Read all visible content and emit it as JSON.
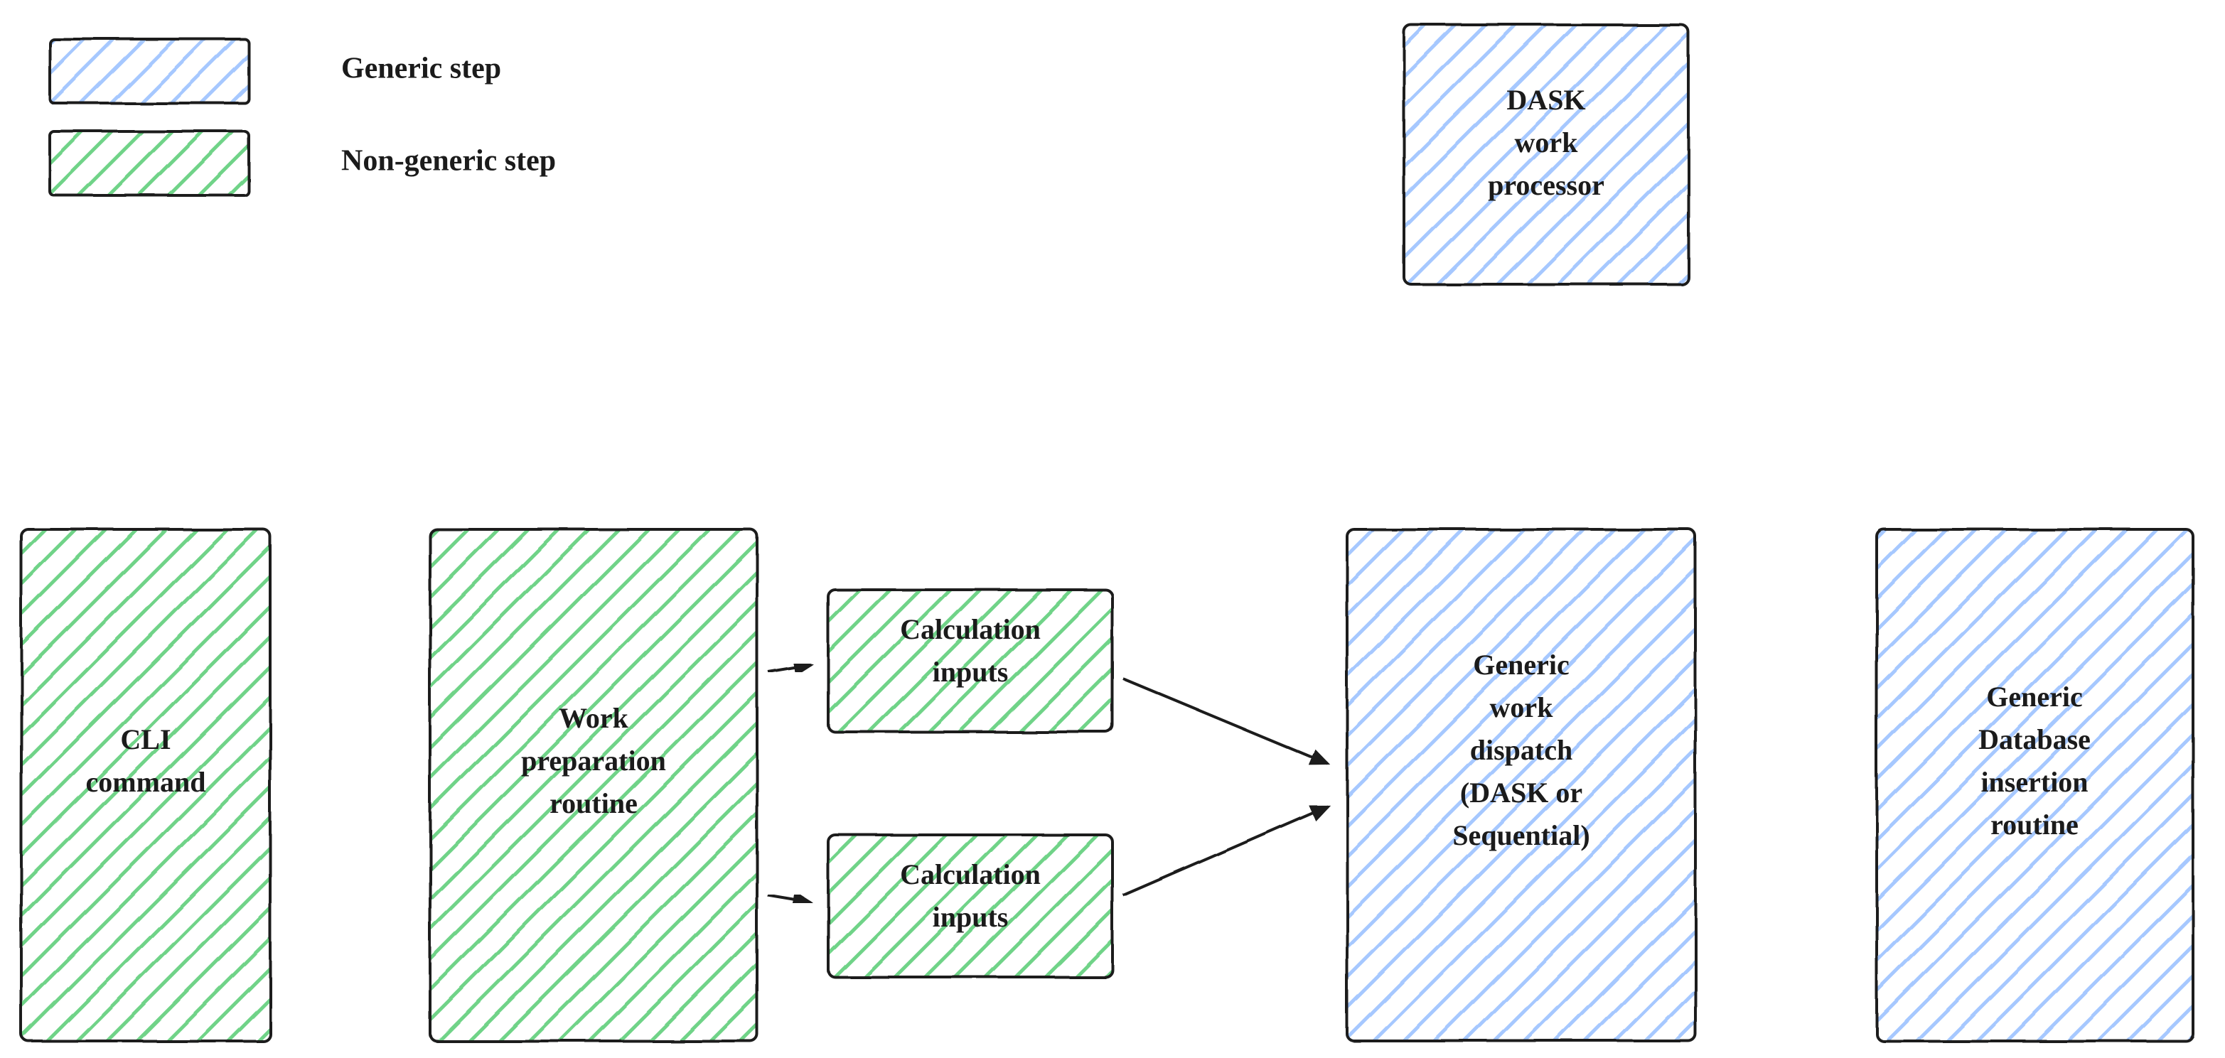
{
  "diagram": {
    "legend": {
      "blue_label": "Generic step",
      "green_label": "Non-generic step"
    },
    "nodes": {
      "cli": {
        "text": "CLI\ncommand",
        "type": "green"
      },
      "prep": {
        "text": "Work\npreparation\nroutine",
        "type": "green"
      },
      "calc1": {
        "text": "Calculation\ninputs",
        "type": "green"
      },
      "calc2": {
        "text": "Calculation\ninputs",
        "type": "green"
      },
      "dask": {
        "text": "DASK\nwork\nprocessor",
        "type": "blue"
      },
      "dispatch": {
        "text": "Generic\nwork\ndispatch\n(DASK or\nSequential)",
        "type": "blue"
      },
      "db": {
        "text": "Generic\nDatabase\ninsertion\nroutine",
        "type": "blue"
      }
    },
    "edges": [
      {
        "from": "cli",
        "to": "prep"
      },
      {
        "from": "prep",
        "to": "calc1"
      },
      {
        "from": "prep",
        "to": "calc2"
      },
      {
        "from": "calc1",
        "to": "dispatch"
      },
      {
        "from": "calc2",
        "to": "dispatch"
      },
      {
        "from": "dispatch",
        "to": "dask",
        "bidirectional": true
      },
      {
        "from": "dispatch",
        "to": "db"
      }
    ],
    "colors": {
      "blue": "#a6c8ff",
      "green": "#6fd388",
      "stroke": "#1b1b1b"
    }
  }
}
